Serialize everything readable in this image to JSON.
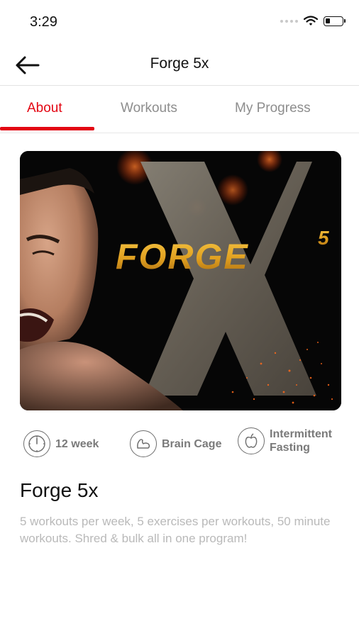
{
  "status_bar": {
    "time": "3:29",
    "icons": [
      "signal-dots",
      "wifi-icon",
      "battery-icon"
    ],
    "battery_level": 0.25
  },
  "nav": {
    "title": "Forge 5x",
    "back_icon": "arrow-left-icon"
  },
  "tabs": [
    {
      "label": "About",
      "active": true
    },
    {
      "label": "Workouts",
      "active": false
    },
    {
      "label": "My Progress",
      "active": false
    }
  ],
  "hero": {
    "logo_text": "FORGE",
    "logo_superscript": "5"
  },
  "stats": [
    {
      "icon": "clock-icon",
      "label": "12 week"
    },
    {
      "icon": "flexed-arm-icon",
      "label": "Brain Cage"
    },
    {
      "icon": "apple-icon",
      "label": "Intermittent Fasting"
    }
  ],
  "program": {
    "title": "Forge 5x",
    "description": "5 workouts per week, 5 exercises per workouts, 50 minute workouts. Shred & bulk all in one program!"
  },
  "colors": {
    "accent": "#e30613",
    "tab_inactive": "#8d8d8d",
    "description": "#b9b9b9",
    "logo_gold": "#e0a020"
  }
}
